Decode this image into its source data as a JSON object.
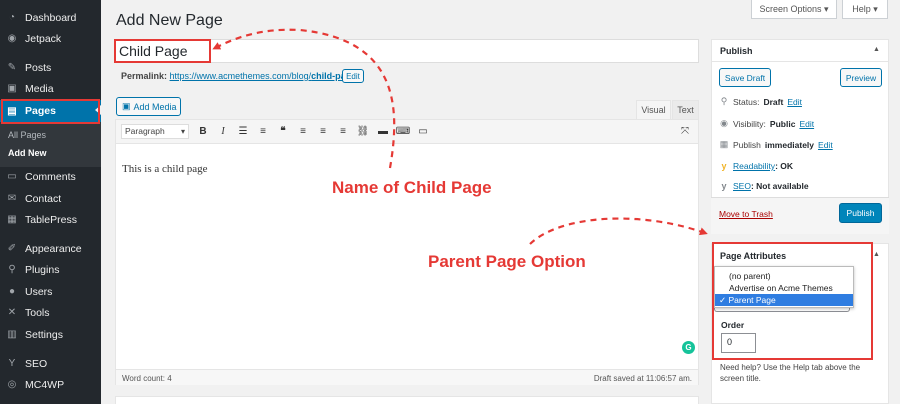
{
  "sidebar": {
    "items": [
      {
        "label": "Dashboard",
        "icon": "dashboard-icon",
        "glyph": "◔"
      },
      {
        "label": "Jetpack",
        "icon": "jetpack-icon",
        "glyph": "◉"
      },
      {
        "label": "Posts",
        "icon": "pin-icon",
        "glyph": "✎"
      },
      {
        "label": "Media",
        "icon": "media-icon",
        "glyph": "▣"
      },
      {
        "label": "Pages",
        "icon": "pages-icon",
        "glyph": "▤"
      },
      {
        "label": "Comments",
        "icon": "comment-icon",
        "glyph": "▭"
      },
      {
        "label": "Contact",
        "icon": "mail-icon",
        "glyph": "✉"
      },
      {
        "label": "TablePress",
        "icon": "table-icon",
        "glyph": "▦"
      },
      {
        "label": "Appearance",
        "icon": "brush-icon",
        "glyph": "✐"
      },
      {
        "label": "Plugins",
        "icon": "plugin-icon",
        "glyph": "⚲"
      },
      {
        "label": "Users",
        "icon": "user-icon",
        "glyph": "●"
      },
      {
        "label": "Tools",
        "icon": "wrench-icon",
        "glyph": "✕"
      },
      {
        "label": "Settings",
        "icon": "settings-icon",
        "glyph": "▥"
      },
      {
        "label": "SEO",
        "icon": "yoast-icon",
        "glyph": "Y"
      },
      {
        "label": "MC4WP",
        "icon": "mc4wp-icon",
        "glyph": "◎"
      }
    ],
    "submenu": [
      "All Pages",
      "Add New"
    ]
  },
  "header": {
    "title": "Add New Page",
    "screen_options": "Screen Options ▾",
    "help": "Help ▾"
  },
  "title_field": {
    "value": "Child Page"
  },
  "permalink": {
    "label": "Permalink:",
    "base": "https://www.acmethemes.com/blog/",
    "slug": "child-page",
    "trail": "/",
    "edit": "Edit"
  },
  "editor": {
    "add_media": "Add Media",
    "tab_visual": "Visual",
    "tab_text": "Text",
    "format": "Paragraph",
    "content": "This is a child page",
    "word_count": "Word count: 4",
    "draft_saved": "Draft saved at 11:06:57 am."
  },
  "publish": {
    "title": "Publish",
    "save_draft": "Save Draft",
    "preview": "Preview",
    "status_label": "Status:",
    "status_value": "Draft",
    "visibility_label": "Visibility:",
    "visibility_value": "Public",
    "publish_label": "Publish",
    "publish_value": "immediately",
    "readability_label": "Readability",
    "readability_value": ": OK",
    "seo_label": "SEO",
    "seo_value": ": Not available",
    "edit": "Edit",
    "trash": "Move to Trash",
    "publish_button": "Publish"
  },
  "attributes": {
    "title": "Page Attributes",
    "options": [
      "(no parent)",
      "Advertise on Acme Themes",
      "Parent Page"
    ],
    "selected": "✓ Parent Page",
    "order_label": "Order",
    "order_value": "0",
    "help": "Need help? Use the Help tab above the screen title."
  },
  "annotations": {
    "child_name": "Name of Child Page",
    "parent_option": "Parent Page Option"
  },
  "colors": {
    "accent": "#0073aa",
    "annotation": "#e53935",
    "sidebar": "#23282d"
  }
}
